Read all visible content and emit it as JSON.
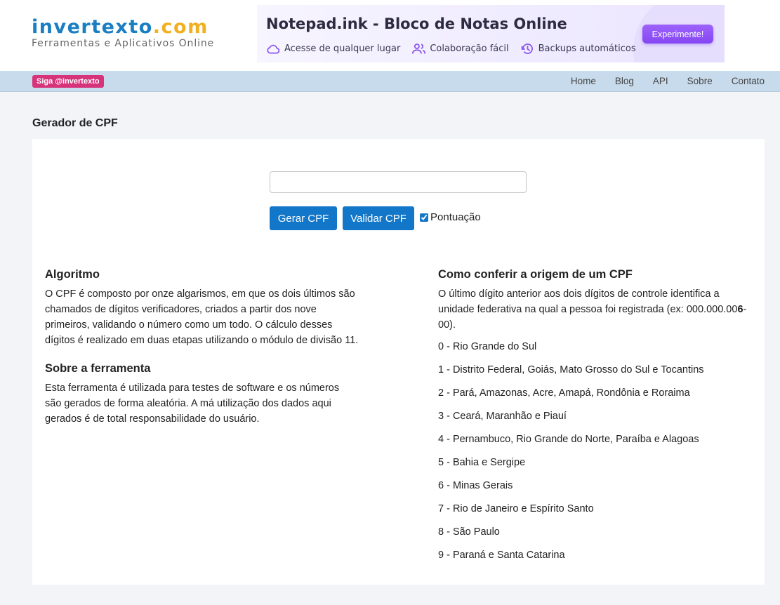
{
  "header": {
    "logo_main_a": "invertexto",
    "logo_main_b": ".com",
    "logo_sub": "Ferramentas e Aplicativos Online"
  },
  "ad": {
    "title": "Notepad.ink - Bloco de Notas Online",
    "features": [
      {
        "icon": "cloud-icon",
        "label": "Acesse de qualquer lugar"
      },
      {
        "icon": "users-icon",
        "label": "Colaboração fácil"
      },
      {
        "icon": "history-icon",
        "label": "Backups automáticos"
      }
    ],
    "cta": "Experimente!"
  },
  "nav": {
    "follow": "Siga @invertexto",
    "links": [
      "Home",
      "Blog",
      "API",
      "Sobre",
      "Contato"
    ]
  },
  "page": {
    "title": "Gerador de CPF"
  },
  "tool": {
    "input_value": "",
    "gerar_label": "Gerar CPF",
    "validar_label": "Validar CPF",
    "checkbox_label": "Pontuação",
    "checkbox_checked": true
  },
  "algoritmo": {
    "heading": "Algoritmo",
    "text": "O CPF é composto por onze algarismos, em que os dois últimos são chamados de dígitos verificadores, criados a partir dos nove primeiros, validando o número como um todo. O cálculo desses dígitos é realizado em duas etapas utilizando o módulo de divisão 11."
  },
  "sobre": {
    "heading": "Sobre a ferramenta",
    "text": "Esta ferramenta é utilizada para testes de software e os números são gerados de forma aleatória. A má utilização dos dados aqui gerados é de total responsabilidade do usuário."
  },
  "origem": {
    "heading": "Como conferir a origem de um CPF",
    "text_before": "O último dígito anterior aos dois dígitos de controle identifica a unidade federativa na qual a pessoa foi registrada (ex: 000.000.00",
    "text_bold": "6",
    "text_after": "-00).",
    "items": [
      "0 - Rio Grande do Sul",
      "1 - Distrito Federal, Goiás, Mato Grosso do Sul e Tocantins",
      "2 - Pará, Amazonas, Acre, Amapá, Rondônia e Roraima",
      "3 - Ceará, Maranhão e Piauí",
      "4 - Pernambuco, Rio Grande do Norte, Paraíba e Alagoas",
      "5 - Bahia e Sergipe",
      "6 - Minas Gerais",
      "7 - Rio de Janeiro e Espírito Santo",
      "8 - São Paulo",
      "9 - Paraná e Santa Catarina"
    ]
  }
}
